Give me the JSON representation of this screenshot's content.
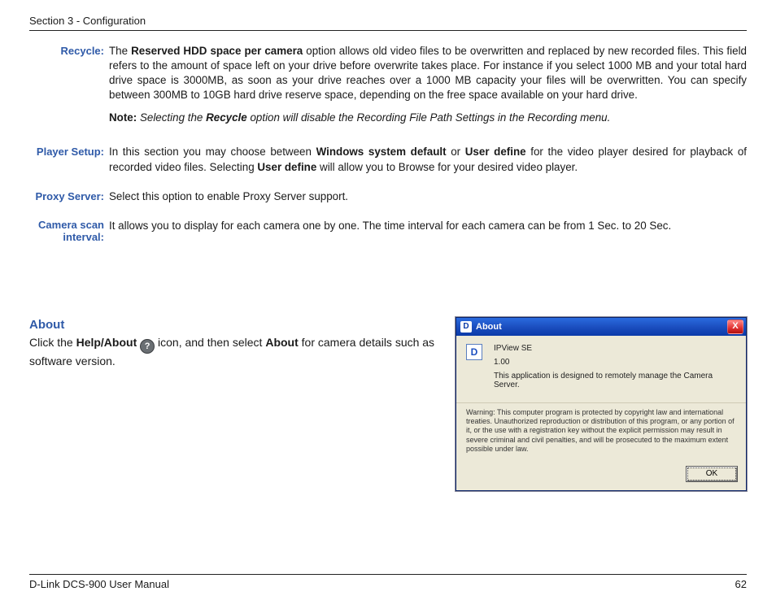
{
  "header": {
    "section": "Section 3 - Configuration"
  },
  "defs": {
    "recycle": {
      "label": "Recycle:",
      "p1_a": "The ",
      "p1_b": "Reserved HDD space per camera",
      "p1_c": " option allows old video files to be overwritten and replaced by new recorded files. This field refers to the amount of space left on your drive before overwrite takes place. For instance if you select 1000 MB and your total hard drive space is 3000MB, as soon as your drive reaches over a 1000 MB capacity your files will be overwritten. You can specify between 300MB to 10GB hard drive reserve space, depending on the free space available on your hard drive.",
      "note_a": "Note:",
      "note_b": " Selecting the ",
      "note_c": "Recycle",
      "note_d": " option will disable the Recording File Path Settings in the Recording menu."
    },
    "player": {
      "label": "Player Setup:",
      "t1": "In this section you may choose between ",
      "t2": "Windows system default",
      "t3": " or ",
      "t4": "User define",
      "t5": " for the video player desired for playback of recorded video files. Selecting ",
      "t6": "User define",
      "t7": " will allow you to Browse for your desired video player."
    },
    "proxy": {
      "label": "Proxy Server:",
      "text": "Select this option to enable Proxy Server support."
    },
    "scan": {
      "label": "Camera scan interval:",
      "text": "It allows you to display for each camera one by one. The time interval for each camera can be from 1 Sec. to 20 Sec."
    }
  },
  "about": {
    "heading": "About",
    "t1": "Click the ",
    "t2": "Help/About",
    "t3": "  ",
    "t4": " icon, and then select ",
    "t5": "About",
    "t6": " for camera details such as software version."
  },
  "dialog": {
    "title": "About",
    "product": "IPView SE",
    "version": "1.00",
    "desc": "This application is designed to remotely manage the Camera Server.",
    "warning": "Warning: This computer program is protected by copyright law and international treaties. Unauthorized reproduction or distribution of this program, or any portion of it, or the use with a registration key without the explicit permission may result in severe criminal and civil penalties, and will be prosecuted to the maximum extent possible under law.",
    "ok": "OK"
  },
  "footer": {
    "left": "D-Link DCS-900 User Manual",
    "page": "62"
  },
  "icons": {
    "help": "?",
    "d": "D",
    "close": "X"
  }
}
